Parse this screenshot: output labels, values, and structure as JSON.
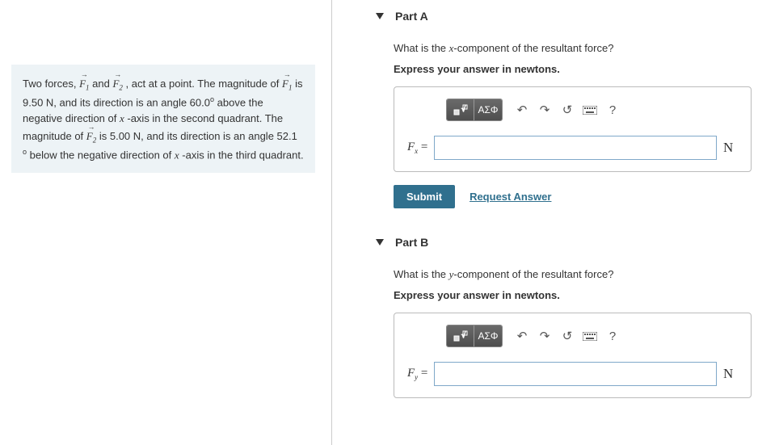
{
  "problem": {
    "s1": "Two forces, ",
    "f1": "F",
    "s2": " and ",
    "f2": "F",
    "s3": ", act at a point. The magnitude of ",
    "f1b": "F",
    "s4": " is 9.50 N, and its direction is an angle 60.0",
    "s5": " above the negative direction of ",
    "xaxis1": "x",
    "s6": "-axis in the second quadrant. The magnitude of ",
    "f2b": "F",
    "s7": " is 5.00 N, and its direction is an angle 52.1 ",
    "s8": " below the negative direction of ",
    "xaxis2": "x",
    "s9": "-axis in the third quadrant.",
    "sub1": "1",
    "sub2": "2",
    "deg": "o"
  },
  "partA": {
    "title": "Part A",
    "question_pre": "What is the ",
    "question_var": "x",
    "question_post": "-component of the resultant force?",
    "instruction": "Express your answer in newtons.",
    "label_sym": "F",
    "label_sub": "x",
    "equals": " = ",
    "unit": "N"
  },
  "partB": {
    "title": "Part B",
    "question_pre": "What is the ",
    "question_var": "y",
    "question_post": "-component of the resultant force?",
    "instruction": "Express your answer in newtons.",
    "label_sym": "F",
    "label_sub": "y",
    "equals": " = ",
    "unit": "N"
  },
  "toolbar": {
    "greek": "ΑΣΦ",
    "undo": "↶",
    "redo": "↷",
    "reset": "↺",
    "help": "?"
  },
  "actions": {
    "submit": "Submit",
    "request": "Request Answer"
  }
}
